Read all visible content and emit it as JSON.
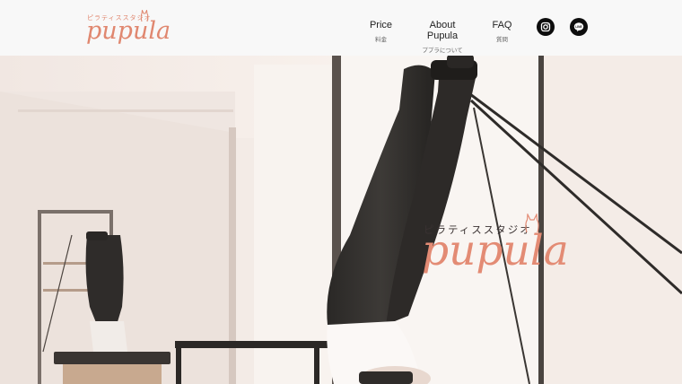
{
  "brand": {
    "subtitle": "ピラティススタジオ",
    "name": "pupula"
  },
  "nav": {
    "items": [
      {
        "id": "price",
        "label": "Price",
        "sublabel": "料金"
      },
      {
        "id": "about",
        "label": "About Pupula",
        "sublabel": "ププラについて"
      },
      {
        "id": "faq",
        "label": "FAQ",
        "sublabel": "質問"
      }
    ]
  },
  "social": [
    {
      "name": "instagram-icon"
    },
    {
      "name": "line-icon",
      "label": "LINE"
    }
  ],
  "hero": {
    "subtitle": "ピラティススタジオ",
    "name": "pupula"
  },
  "colors": {
    "brand": "#e0876f",
    "header_bg": "#f8f8f8",
    "icon_bg": "#0d0d0d"
  }
}
